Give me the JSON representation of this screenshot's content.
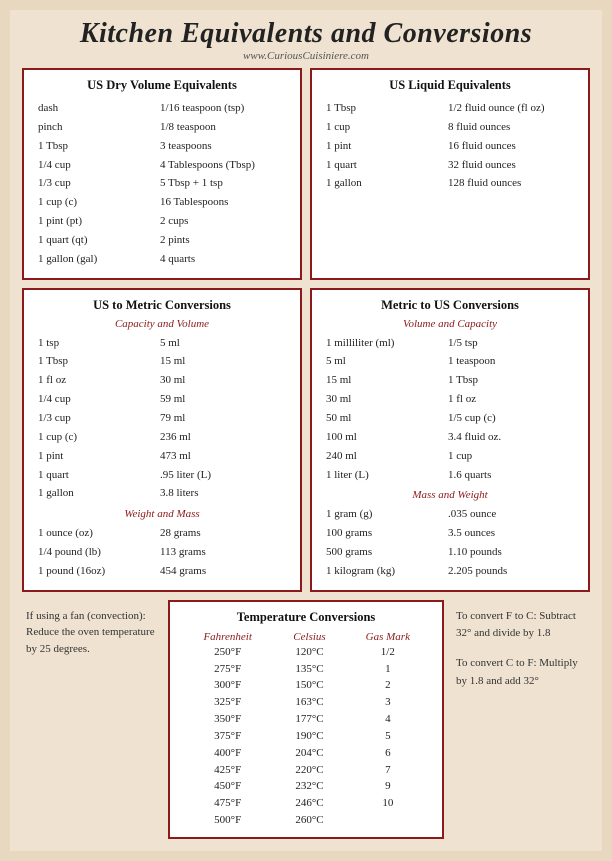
{
  "header": {
    "title": "Kitchen Equivalents and Conversions",
    "website": "www.CuriousCuisiniere.com"
  },
  "dry_volume": {
    "title": "US Dry Volume Equivalents",
    "rows": [
      [
        "dash",
        "1/16 teaspoon (tsp)"
      ],
      [
        "pinch",
        "1/8 teaspoon"
      ],
      [
        "1 Tbsp",
        "3 teaspoons"
      ],
      [
        "1/4 cup",
        "4 Tablespoons (Tbsp)"
      ],
      [
        "1/3 cup",
        "5 Tbsp + 1 tsp"
      ],
      [
        "1 cup (c)",
        "16 Tablespoons"
      ],
      [
        "1 pint (pt)",
        "2 cups"
      ],
      [
        "1 quart (qt)",
        "2 pints"
      ],
      [
        "1 gallon (gal)",
        "4 quarts"
      ]
    ]
  },
  "liquid_equiv": {
    "title": "US Liquid Equivalents",
    "rows": [
      [
        "1 Tbsp",
        "1/2 fluid ounce (fl oz)"
      ],
      [
        "1 cup",
        "8 fluid ounces"
      ],
      [
        "1 pint",
        "16 fluid ounces"
      ],
      [
        "1 quart",
        "32 fluid ounces"
      ],
      [
        "1 gallon",
        "128 fluid ounces"
      ]
    ]
  },
  "us_to_metric": {
    "title": "US to Metric Conversions",
    "subtitle_volume": "Capacity and Volume",
    "volume_rows": [
      [
        "1 tsp",
        "5 ml"
      ],
      [
        "1 Tbsp",
        "15 ml"
      ],
      [
        "1 fl oz",
        "30 ml"
      ],
      [
        "1/4 cup",
        "59 ml"
      ],
      [
        "1/3 cup",
        "79 ml"
      ],
      [
        "1 cup (c)",
        "236 ml"
      ],
      [
        "1 pint",
        "473 ml"
      ],
      [
        "1 quart",
        ".95 liter (L)"
      ],
      [
        "1 gallon",
        "3.8 liters"
      ]
    ],
    "subtitle_mass": "Weight and Mass",
    "mass_rows": [
      [
        "1 ounce (oz)",
        "28 grams"
      ],
      [
        "1/4 pound (lb)",
        "113 grams"
      ],
      [
        "1 pound (16oz)",
        "454 grams"
      ]
    ]
  },
  "metric_to_us": {
    "title": "Metric to US Conversions",
    "subtitle_volume": "Volume and Capacity",
    "volume_rows": [
      [
        "1 milliliter (ml)",
        "1/5 tsp"
      ],
      [
        "5 ml",
        "1 teaspoon"
      ],
      [
        "15 ml",
        "1 Tbsp"
      ],
      [
        "30 ml",
        "1 fl oz"
      ],
      [
        "50 ml",
        "1/5 cup (c)"
      ],
      [
        "100 ml",
        "3.4 fluid oz."
      ],
      [
        "240 ml",
        "1 cup"
      ],
      [
        "1 liter (L)",
        "1.6 quarts"
      ]
    ],
    "subtitle_mass": "Mass and Weight",
    "mass_rows": [
      [
        "1 gram (g)",
        ".035 ounce"
      ],
      [
        "100 grams",
        "3.5 ounces"
      ],
      [
        "500 grams",
        "1.10 pounds"
      ],
      [
        "1 kilogram (kg)",
        "2.205 pounds"
      ]
    ]
  },
  "temperature": {
    "title": "Temperature Conversions",
    "headers": [
      "Fahrenheit",
      "Celsius",
      "Gas Mark"
    ],
    "rows": [
      [
        "250°F",
        "120°C",
        "1/2"
      ],
      [
        "275°F",
        "135°C",
        "1"
      ],
      [
        "300°F",
        "150°C",
        "2"
      ],
      [
        "325°F",
        "163°C",
        "3"
      ],
      [
        "350°F",
        "177°C",
        "4"
      ],
      [
        "375°F",
        "190°C",
        "5"
      ],
      [
        "400°F",
        "204°C",
        "6"
      ],
      [
        "425°F",
        "220°C",
        "7"
      ],
      [
        "450°F",
        "232°C",
        "9"
      ],
      [
        "475°F",
        "246°C",
        "10"
      ],
      [
        "500°F",
        "260°C",
        ""
      ]
    ]
  },
  "fan_note": "If using a fan (convection): Reduce the oven temperature by 25 degrees.",
  "convert_ftoc": "To convert F to C: Subtract 32° and divide by 1.8",
  "convert_ctof": "To convert C to F: Multiply by 1.8 and add 32°"
}
